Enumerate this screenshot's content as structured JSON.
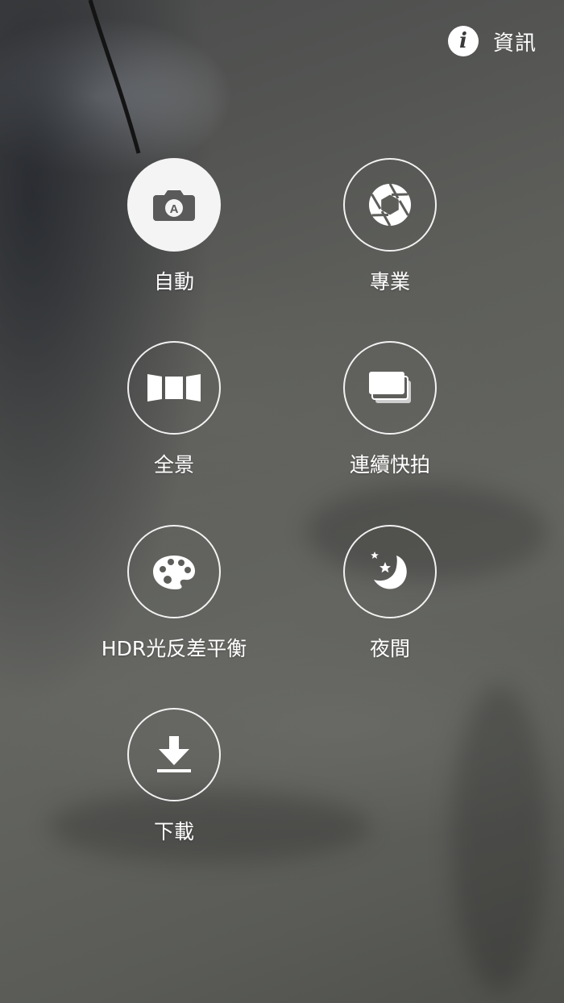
{
  "info": {
    "icon": "info-icon",
    "icon_glyph": "i",
    "label": "資訊"
  },
  "modes": [
    {
      "key": "auto",
      "label": "自動",
      "icon": "camera-auto-icon",
      "selected": true
    },
    {
      "key": "pro",
      "label": "專業",
      "icon": "aperture-icon",
      "selected": false
    },
    {
      "key": "panorama",
      "label": "全景",
      "icon": "panorama-icon",
      "selected": false
    },
    {
      "key": "burst",
      "label": "連續快拍",
      "icon": "burst-stack-icon",
      "selected": false
    },
    {
      "key": "hdr",
      "label": "HDR光反差平衡",
      "icon": "palette-icon",
      "selected": false
    },
    {
      "key": "night",
      "label": "夜間",
      "icon": "moon-stars-icon",
      "selected": false
    },
    {
      "key": "download",
      "label": "下載",
      "icon": "download-icon",
      "selected": false
    }
  ],
  "colors": {
    "icon_white": "#ffffff",
    "active_fill": "#f4f4f4",
    "active_icon": "#5a5a5a"
  }
}
